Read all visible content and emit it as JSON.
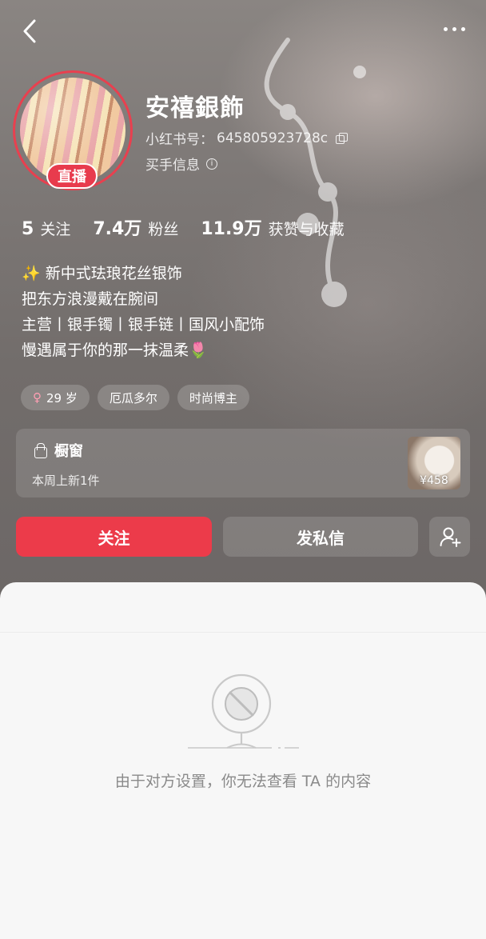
{
  "header": {
    "back_icon": "chevron-left-icon",
    "more_icon": "more-horizontal-icon"
  },
  "profile": {
    "nickname": "安禧銀飾",
    "live_badge": "直播",
    "xhs_id_label": "小红书号：",
    "xhs_id": "645805923728c",
    "buyer_info": "买手信息",
    "accent_color": "#e83b4d"
  },
  "stats": [
    {
      "num": "5",
      "label": "关注"
    },
    {
      "num": "7.4万",
      "label": "粉丝"
    },
    {
      "num": "11.9万",
      "label": "获赞与收藏"
    }
  ],
  "bio": {
    "line1": "✨ 新中式珐琅花丝银饰",
    "line2": "把东方浪漫戴在腕间",
    "line3": "主营丨银手镯丨银手链丨国风小配饰",
    "line4": "慢遇属于你的那一抹温柔🌷"
  },
  "tags": {
    "age": "29 岁",
    "location": "厄瓜多尔",
    "category": "时尚博主"
  },
  "shop": {
    "title": "橱窗",
    "subtitle": "本周上新1件",
    "price": "¥458"
  },
  "actions": {
    "follow": "关注",
    "message": "发私信"
  },
  "content": {
    "empty_message": "由于对方设置，你无法查看 TA 的内容"
  }
}
